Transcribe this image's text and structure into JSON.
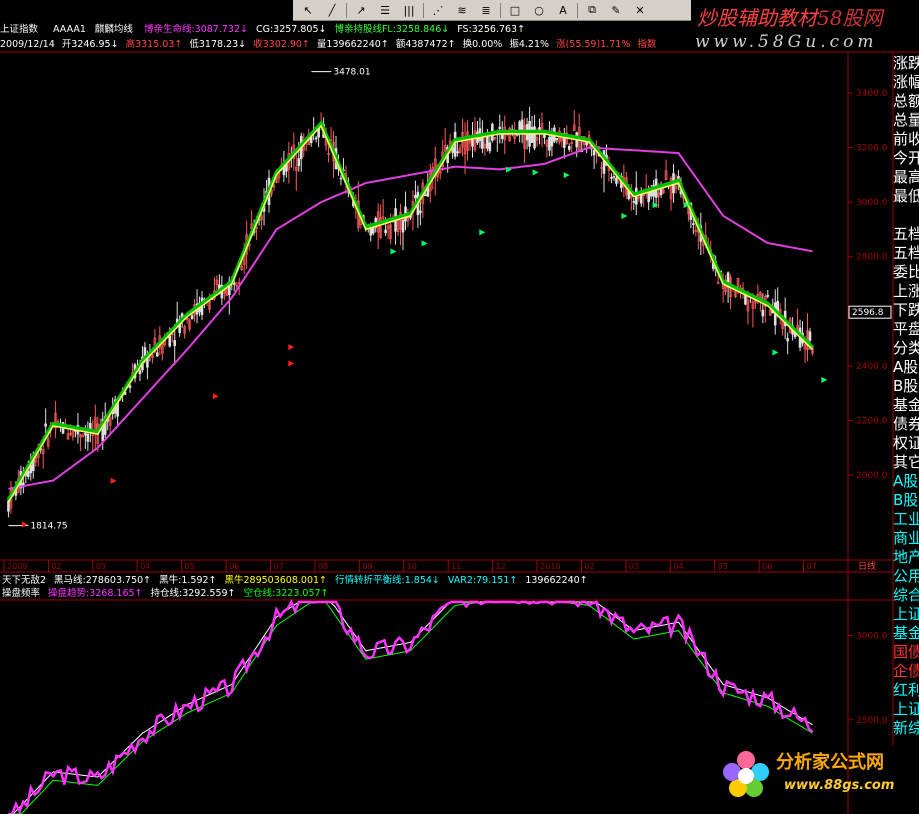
{
  "toolbar": {
    "icons": [
      "cursor-icon",
      "line-icon",
      "ray-icon",
      "parallel-icon",
      "vertical-lines-icon",
      "fan-icon",
      "channel-icon",
      "fib-icon",
      "rectangle-icon",
      "ellipse-icon",
      "text-icon",
      "copy-icon",
      "eraser-icon",
      "delete-icon"
    ]
  },
  "brand": {
    "title_main": "炒股辅助教材",
    "title_site": "58股网",
    "url": "www.58Gu.com"
  },
  "header": {
    "index_name": "上证指数",
    "indicator_id": "AAAA1",
    "indicator_name": "麒麟均线",
    "items": [
      {
        "text": "博亲生命线:3087.732↓",
        "color": "#ff33ff"
      },
      {
        "text": "CG:3257.805↓",
        "color": "#ffffff"
      },
      {
        "text": "博亲持股线FL:3258.846↓",
        "color": "#33ff33"
      },
      {
        "text": "FS:3256.763↑",
        "color": "#ffffff"
      }
    ]
  },
  "quote": {
    "date": "2009/12/14",
    "open": "开3246.95↓",
    "high": "高3315.03↑",
    "low": "低3178.23↓",
    "close": "收3302.90↑",
    "volume": "量139662240↑",
    "amount": "额4387472↑",
    "turnover": "换0.00%",
    "amplitude": "振4.21%",
    "change": "涨(55.59)1.71%",
    "indicator_tag": "指数"
  },
  "price_axis": {
    "labels": [
      "3400.0",
      "3200.0",
      "3000.0",
      "2800.0",
      "2600.0",
      "2400.0",
      "2200.0",
      "2000.0"
    ],
    "current": "2596.8"
  },
  "annotations": {
    "high_label": "3478.01",
    "low_label": "1814.75"
  },
  "time_axis": {
    "labels": [
      "2009",
      "02",
      "03",
      "04",
      "05",
      "06",
      "07",
      "08",
      "09",
      "10",
      "11",
      "12",
      "2010",
      "02",
      "03",
      "04",
      "05",
      "06",
      "07"
    ],
    "unit": "日线"
  },
  "mid_row": {
    "items": [
      {
        "text": "天下无敌2",
        "color": "#ffffff"
      },
      {
        "text": "黑马线:278603.750↑",
        "color": "#ffffff"
      },
      {
        "text": "黑牛:1.592↑",
        "color": "#ffffff"
      },
      {
        "text": "黑牛289503608.001↑",
        "color": "#ffff00"
      },
      {
        "text": "行情转折平衡线:1.854↓",
        "color": "#00ffff"
      },
      {
        "text": "VAR2:79.151↑",
        "color": "#00ffff"
      },
      {
        "text": "139662240↑",
        "color": "#ffffff"
      }
    ]
  },
  "lower_header": {
    "items": [
      {
        "text": "操盘频率",
        "color": "#ffffff"
      },
      {
        "text": "操盘趋势:3268.165↑",
        "color": "#ff33ff"
      },
      {
        "text": "持仓线:3292.559↑",
        "color": "#ffffff"
      },
      {
        "text": "空仓线:3223.057↑",
        "color": "#00ff00"
      }
    ]
  },
  "lower_axis": {
    "labels": [
      "3000.0",
      "2500.0"
    ]
  },
  "right_panel": {
    "items": [
      {
        "text": "涨跌",
        "class": ""
      },
      {
        "text": "涨幅",
        "class": ""
      },
      {
        "text": "总额",
        "class": ""
      },
      {
        "text": "总量",
        "class": ""
      },
      {
        "text": "前收",
        "class": ""
      },
      {
        "text": "今开",
        "class": ""
      },
      {
        "text": "最高",
        "class": ""
      },
      {
        "text": "最低",
        "class": ""
      },
      {
        "text": "",
        "class": ""
      },
      {
        "text": "五档",
        "class": ""
      },
      {
        "text": "五档",
        "class": ""
      },
      {
        "text": "委比",
        "class": ""
      },
      {
        "text": "上涨",
        "class": ""
      },
      {
        "text": "下跌",
        "class": ""
      },
      {
        "text": "平盘",
        "class": ""
      },
      {
        "text": "分类",
        "class": ""
      },
      {
        "text": "A股",
        "class": ""
      },
      {
        "text": "B股",
        "class": ""
      },
      {
        "text": "基金",
        "class": ""
      },
      {
        "text": "债券",
        "class": ""
      },
      {
        "text": "权证",
        "class": ""
      },
      {
        "text": "其它",
        "class": ""
      },
      {
        "text": "A股",
        "class": "cyan"
      },
      {
        "text": "B股",
        "class": "cyan"
      },
      {
        "text": "工业",
        "class": "cyan"
      },
      {
        "text": "商业",
        "class": "cyan"
      },
      {
        "text": "地产",
        "class": "cyan"
      },
      {
        "text": "公用",
        "class": "cyan"
      },
      {
        "text": "综合",
        "class": "cyan"
      },
      {
        "text": "上证",
        "class": "cyan"
      },
      {
        "text": "基金",
        "class": "cyan"
      },
      {
        "text": "国债",
        "class": "red"
      },
      {
        "text": "企债",
        "class": "red"
      },
      {
        "text": "红利",
        "class": "cyan"
      },
      {
        "text": "上证",
        "class": "cyan"
      },
      {
        "text": "新综",
        "class": "cyan"
      }
    ]
  },
  "logo": {
    "title": "分析家公式网",
    "url": "www.88gs.com"
  },
  "chart_data": {
    "type": "line",
    "x": [
      "2009-01",
      "2009-02",
      "2009-03",
      "2009-04",
      "2009-05",
      "2009-06",
      "2009-07",
      "2009-08",
      "2009-09",
      "2009-10",
      "2009-11",
      "2009-12",
      "2010-01",
      "2010-02",
      "2010-03",
      "2010-04",
      "2010-05",
      "2010-06",
      "2010-07"
    ],
    "ylim": [
      1700,
      3550
    ],
    "series": [
      {
        "name": "博亲生命线",
        "values": [
          1950,
          1980,
          2100,
          2280,
          2460,
          2650,
          2900,
          3000,
          3070,
          3100,
          3130,
          3120,
          3140,
          3200,
          3190,
          3180,
          2950,
          2850,
          2820
        ]
      },
      {
        "name": "博亲持股线FL",
        "values": [
          1900,
          2180,
          2150,
          2410,
          2580,
          2700,
          3100,
          3280,
          2900,
          2950,
          3220,
          3250,
          3250,
          3220,
          3020,
          3070,
          2700,
          2620,
          2460
        ]
      }
    ],
    "high_label": "3478.01",
    "low_label": "1814.75"
  }
}
